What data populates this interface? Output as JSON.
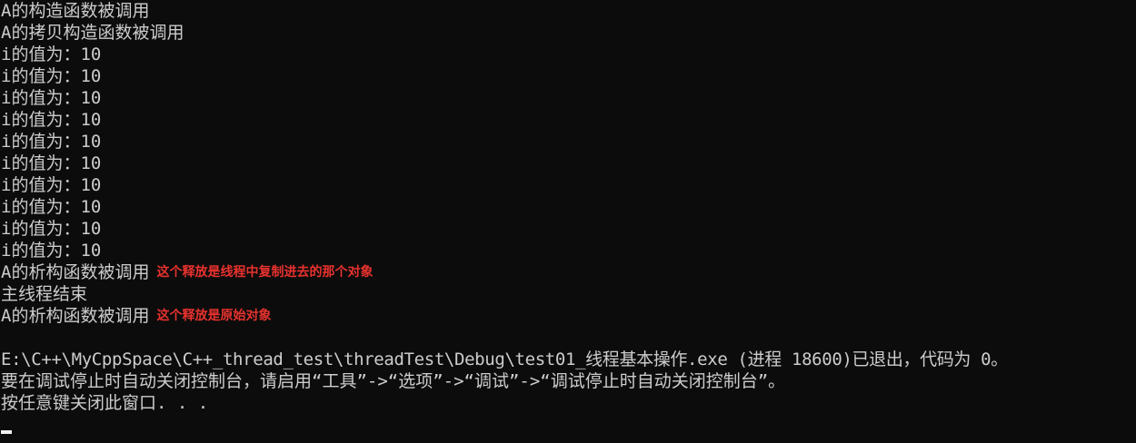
{
  "console": {
    "lines": [
      "A的构造函数被调用",
      "A的拷贝构造函数被调用",
      "i的值为：10",
      "i的值为：10",
      "i的值为：10",
      "i的值为：10",
      "i的值为：10",
      "i的值为：10",
      "i的值为：10",
      "i的值为：10",
      "i的值为：10",
      "i的值为：10",
      "A的析构函数被调用",
      "主线程结束",
      "A的析构函数被调用",
      "",
      "E:\\C++\\MyCppSpace\\C++_thread_test\\threadTest\\Debug\\test01_线程基本操作.exe (进程 18600)已退出，代码为 0。",
      "要在调试停止时自动关闭控制台，请启用“工具”->“选项”->“调试”->“调试停止时自动关闭控制台”。",
      "按任意键关闭此窗口. . ."
    ],
    "annotations": {
      "copy_release": "这个释放是线程中复制进去的那个对象",
      "original_release": "这个释放是原始对象"
    }
  },
  "colors": {
    "background": "#0c0c0c",
    "text": "#cccccc",
    "annotation": "#e8322e",
    "cursor": "#f2f2f2"
  }
}
